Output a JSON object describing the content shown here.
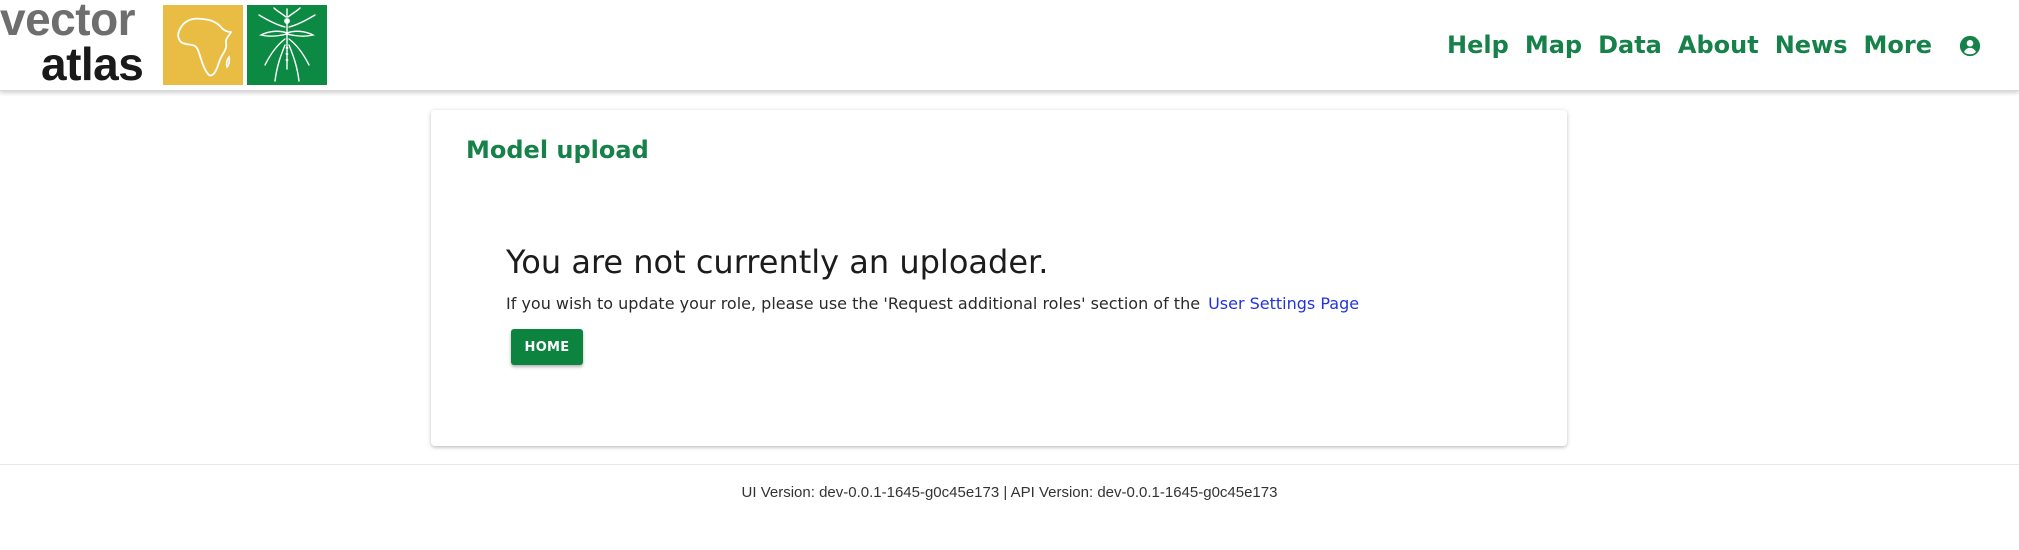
{
  "header": {
    "logo": {
      "word1": "vector",
      "word2": "atlas",
      "africa_icon": "africa-map-icon",
      "mosquito_icon": "mosquito-icon"
    },
    "nav": [
      {
        "label": "Help"
      },
      {
        "label": "Map"
      },
      {
        "label": "Data"
      },
      {
        "label": "About"
      },
      {
        "label": "News"
      },
      {
        "label": "More"
      }
    ],
    "account_icon": "account-circle-icon"
  },
  "card": {
    "title": "Model upload",
    "heading": "You are not currently an uploader.",
    "message": "If you wish to update your role, please use the 'Request additional roles' section of the",
    "link_label": "User Settings Page",
    "home_button_label": "HOME"
  },
  "footer": {
    "version_text": "UI Version: dev-0.0.1-1645-g0c45e173 | API Version: dev-0.0.1-1645-g0c45e173"
  },
  "colors": {
    "brand_green": "#17814a",
    "button_green": "#0c8440",
    "logo_yellow": "#e9bc44",
    "logo_green": "#0c8a43",
    "link_blue": "#2233dd"
  }
}
